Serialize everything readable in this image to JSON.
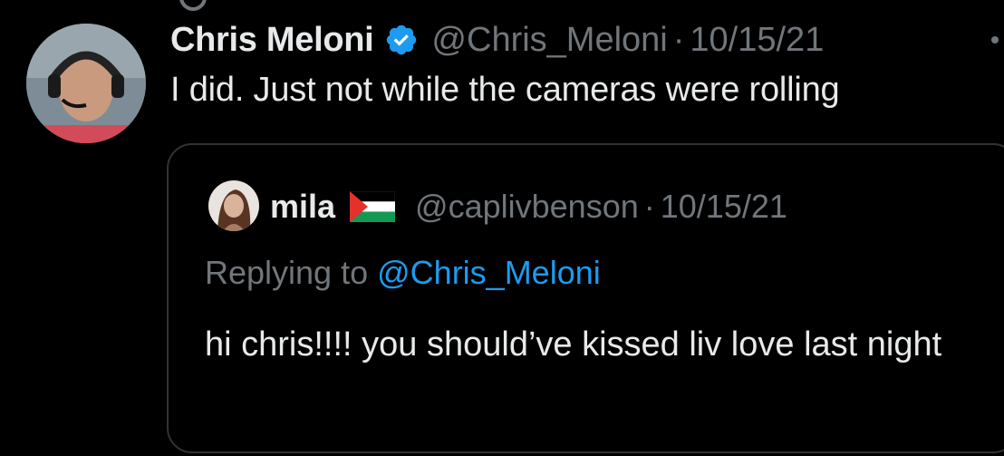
{
  "tweet": {
    "display_name": "Chris Meloni",
    "verified": true,
    "handle": "@Chris_Meloni",
    "separator": "·",
    "date": "10/15/21",
    "text": "I did. Just not while the cameras were rolling"
  },
  "quoted_tweet": {
    "display_name": "mila",
    "flag": "palestine-flag-icon",
    "handle": "@caplivbenson",
    "separator": "·",
    "date": "10/15/21",
    "replying_prefix": "Replying to",
    "replying_to": "@Chris_Meloni",
    "text": "hi chris!!!! you should’ve kissed liv love last night"
  },
  "colors": {
    "background": "#000000",
    "primary_text": "#e7e9ea",
    "secondary_text": "#71767b",
    "link": "#1d9bf0",
    "border": "#2f3336",
    "verified": "#1d9bf0"
  }
}
